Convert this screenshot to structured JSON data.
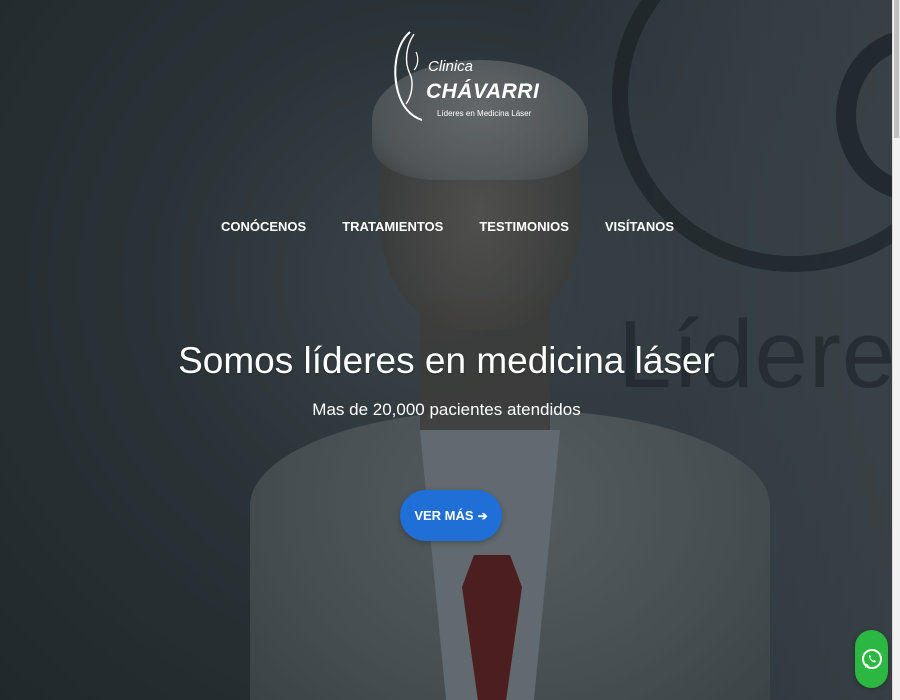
{
  "logo": {
    "line1": "Clinica",
    "line2": "CHÁVARRI",
    "tagline": "Líderes en Medicina Láser"
  },
  "nav": {
    "items": [
      {
        "label": "CONÓCENOS"
      },
      {
        "label": "TRATAMIENTOS"
      },
      {
        "label": "TESTIMONIOS"
      },
      {
        "label": "VISÍTANOS"
      }
    ]
  },
  "hero": {
    "headline": "Somos líderes en medicina láser",
    "subheadline": "Mas de 20,000 pacientes atendidos",
    "cta_label": "VER MÁS",
    "cta_arrow": "➔",
    "background_text": "Líderes en"
  },
  "icons": {
    "cta_arrow": "arrow-right-icon",
    "whatsapp": "whatsapp-icon"
  },
  "colors": {
    "cta": "#1f6fd6",
    "whatsapp": "#2bb741",
    "text": "#ffffff"
  }
}
